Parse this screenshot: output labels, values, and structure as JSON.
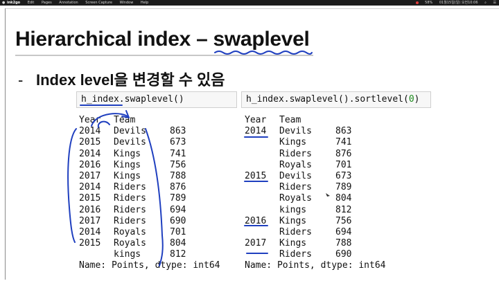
{
  "menubar": {
    "app_name": "ink2go",
    "menus": [
      "Edit",
      "Pages",
      "Annotation",
      "Screen Capture",
      "Window",
      "Help"
    ],
    "status": [
      "58%",
      "01월15일(일) 오전10:06"
    ]
  },
  "slide": {
    "title": "Hierarchical index – swaplevel",
    "bullet_dash": "-",
    "bullet": "Index level을 변경할 수 있음"
  },
  "cells": {
    "left_code": "h_index.swaplevel()",
    "right_code_prefix": "h_index.swaplevel().sortlevel(",
    "right_code_arg": "0",
    "right_code_suffix": ")"
  },
  "left_output": {
    "header_a": "Year",
    "header_b": "Team",
    "rows": [
      {
        "a": "2014",
        "b": "Devils",
        "v": "863"
      },
      {
        "a": "2015",
        "b": "Devils",
        "v": "673"
      },
      {
        "a": "2014",
        "b": "Kings",
        "v": "741"
      },
      {
        "a": "2016",
        "b": "Kings",
        "v": "756"
      },
      {
        "a": "2017",
        "b": "Kings",
        "v": "788"
      },
      {
        "a": "2014",
        "b": "Riders",
        "v": "876"
      },
      {
        "a": "2015",
        "b": "Riders",
        "v": "789"
      },
      {
        "a": "2016",
        "b": "Riders",
        "v": "694"
      },
      {
        "a": "2017",
        "b": "Riders",
        "v": "690"
      },
      {
        "a": "2014",
        "b": "Royals",
        "v": "701"
      },
      {
        "a": "2015",
        "b": "Royals",
        "v": "804"
      },
      {
        "a": "",
        "b": "kings",
        "v": "812"
      }
    ],
    "footer": "Name: Points, dtype: int64"
  },
  "right_output": {
    "header_a": "Year",
    "header_b": "Team",
    "rows": [
      {
        "a": "2014",
        "b": "Devils",
        "v": "863"
      },
      {
        "a": "",
        "b": "Kings",
        "v": "741"
      },
      {
        "a": "",
        "b": "Riders",
        "v": "876"
      },
      {
        "a": "",
        "b": "Royals",
        "v": "701"
      },
      {
        "a": "2015",
        "b": "Devils",
        "v": "673"
      },
      {
        "a": "",
        "b": "Riders",
        "v": "789"
      },
      {
        "a": "",
        "b": "Royals",
        "v": "804"
      },
      {
        "a": "",
        "b": "kings",
        "v": "812"
      },
      {
        "a": "2016",
        "b": "Kings",
        "v": "756"
      },
      {
        "a": "",
        "b": "Riders",
        "v": "694"
      },
      {
        "a": "2017",
        "b": "Kings",
        "v": "788"
      },
      {
        "a": "",
        "b": "Riders",
        "v": "690"
      }
    ],
    "footer": "Name: Points, dtype: int64"
  },
  "colors": {
    "ink": "#1f3fbf",
    "number_literal": "#1a8a1a"
  }
}
